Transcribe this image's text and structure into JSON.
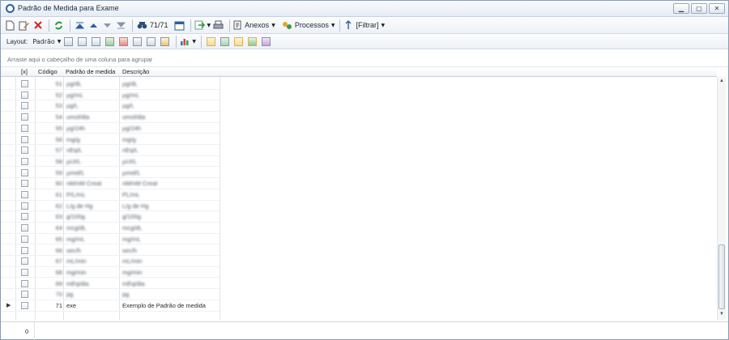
{
  "window": {
    "title": "Padrão de Medida para Exame",
    "buttons": [
      "▁",
      "▢",
      "✕"
    ]
  },
  "toolbar": {
    "record_counter": "71/71",
    "anexos_label": "Anexos",
    "processos_label": "Processos",
    "filtrar_label": "[Filtrar]"
  },
  "toolbar2": {
    "layout_label": "Layout:",
    "padrao_label": "Padrão"
  },
  "group_panel": {
    "hint": "Arraste aqui o cabeçalho de uma coluna para agrupar"
  },
  "grid": {
    "columns": [
      "[x]",
      "Código",
      "Padrão de medida",
      "Descrição"
    ],
    "rows": [
      {
        "codigo": "51",
        "padrao": "µg/dL",
        "descricao": "µg/dL"
      },
      {
        "codigo": "52",
        "padrao": "µg/mL",
        "descricao": "µg/mL"
      },
      {
        "codigo": "53",
        "padrao": "µg/L",
        "descricao": "µg/L"
      },
      {
        "codigo": "54",
        "padrao": "umol/dia",
        "descricao": "umol/dia"
      },
      {
        "codigo": "55",
        "padrao": "µg/24h",
        "descricao": "µg/24h"
      },
      {
        "codigo": "56",
        "padrao": "mg/g",
        "descricao": "mg/g"
      },
      {
        "codigo": "57",
        "padrao": "nEq/L",
        "descricao": "nEq/L"
      },
      {
        "codigo": "58",
        "padrao": "µUI/L",
        "descricao": "µUI/L"
      },
      {
        "codigo": "59",
        "padrao": "µmol/L",
        "descricao": "µmol/L"
      },
      {
        "codigo": "60",
        "padrao": "nM/nM Creat",
        "descricao": "nM/nM Creat"
      },
      {
        "codigo": "61",
        "padrao": "P/L/mL",
        "descricao": "PL/mL"
      },
      {
        "codigo": "62",
        "padrao": "L/g de Hg",
        "descricao": "L/g de Hg"
      },
      {
        "codigo": "63",
        "padrao": "g/100g",
        "descricao": "g/100g"
      },
      {
        "codigo": "64",
        "padrao": "mcg/dL",
        "descricao": "mcg/dL"
      },
      {
        "codigo": "65",
        "padrao": "mg/mL",
        "descricao": "mg/mL"
      },
      {
        "codigo": "66",
        "padrao": "sec/h",
        "descricao": "sec/h"
      },
      {
        "codigo": "67",
        "padrao": "mL/min",
        "descricao": "mL/min"
      },
      {
        "codigo": "68",
        "padrao": "mg/min",
        "descricao": "mg/min"
      },
      {
        "codigo": "69",
        "padrao": "mEq/dia",
        "descricao": "mEq/dia"
      },
      {
        "codigo": "70",
        "padrao": "pg",
        "descricao": "pg"
      },
      {
        "codigo": "71",
        "padrao": "exe",
        "descricao": "Exemplo de Padrão de medida"
      }
    ]
  },
  "footer": {
    "count": "0"
  },
  "colors": {
    "window_border": "#8a9bb0",
    "toolbar_bg": "#edf1f6",
    "accent": "#2d5f9a"
  }
}
